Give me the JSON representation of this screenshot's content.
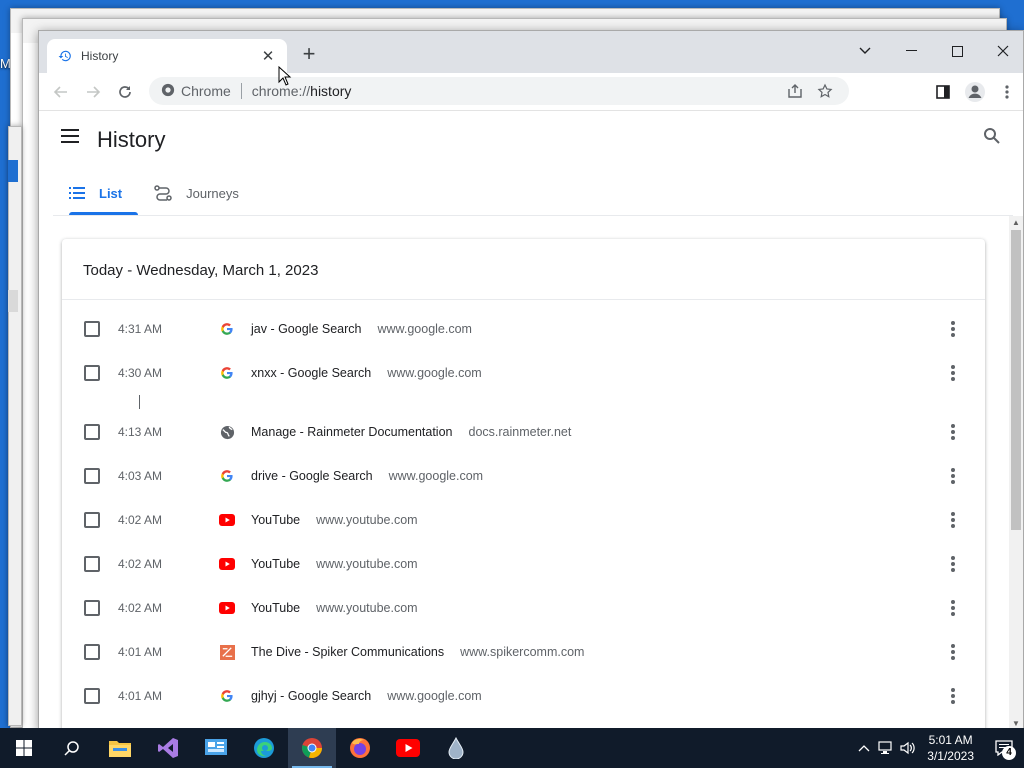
{
  "desktop": {
    "label": "My"
  },
  "browser": {
    "tab_title": "History",
    "new_tab_label": "+",
    "omnibox": {
      "site_label": "Chrome",
      "scheme": "chrome://",
      "path": "history"
    }
  },
  "history_page": {
    "title": "History",
    "tabs": [
      {
        "label": "List",
        "active": true,
        "icon": "list-icon"
      },
      {
        "label": "Journeys",
        "active": false,
        "icon": "journeys-icon"
      }
    ],
    "section_title": "Today - Wednesday, March 1, 2023",
    "rows": [
      {
        "time": "4:31 AM",
        "title": "jav - Google Search",
        "domain": "www.google.com",
        "favicon": "google-icon"
      },
      {
        "time": "4:30 AM",
        "title": "xnxx - Google Search",
        "domain": "www.google.com",
        "favicon": "google-icon"
      },
      {
        "time": "4:13 AM",
        "title": "Manage - Rainmeter Documentation",
        "domain": "docs.rainmeter.net",
        "favicon": "globe-icon"
      },
      {
        "time": "4:03 AM",
        "title": "drive - Google Search",
        "domain": "www.google.com",
        "favicon": "google-icon"
      },
      {
        "time": "4:02 AM",
        "title": "YouTube",
        "domain": "www.youtube.com",
        "favicon": "youtube-icon"
      },
      {
        "time": "4:02 AM",
        "title": "YouTube",
        "domain": "www.youtube.com",
        "favicon": "youtube-icon"
      },
      {
        "time": "4:02 AM",
        "title": "YouTube",
        "domain": "www.youtube.com",
        "favicon": "youtube-icon"
      },
      {
        "time": "4:01 AM",
        "title": "The Dive - Spiker Communications",
        "domain": "www.spikercomm.com",
        "favicon": "spiker-icon"
      },
      {
        "time": "4:01 AM",
        "title": "gjhyj - Google Search",
        "domain": "www.google.com",
        "favicon": "google-icon"
      }
    ]
  },
  "taskbar": {
    "clock_time": "5:01 AM",
    "clock_date": "3/1/2023",
    "notification_count": "4",
    "apps": [
      "windows-start-icon",
      "search-icon",
      "file-explorer-icon",
      "visual-studio-icon",
      "control-panel-icon",
      "edge-icon",
      "chrome-icon",
      "firefox-icon",
      "youtube-icon",
      "rainmeter-icon"
    ]
  },
  "colors": {
    "accent": "#1a73e8",
    "desktop": "#1f6fd1",
    "taskbar": "#101b2a"
  }
}
